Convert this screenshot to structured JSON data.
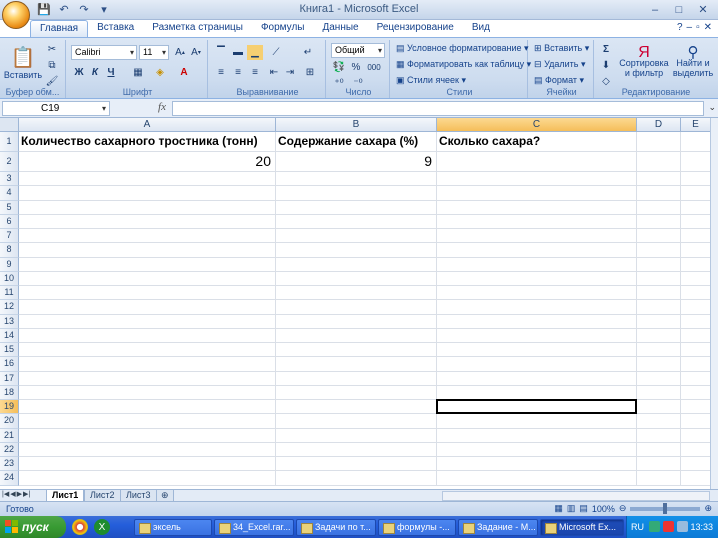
{
  "window": {
    "title": "Книга1 - Microsoft Excel"
  },
  "ribbon_tabs": [
    "Главная",
    "Вставка",
    "Разметка страницы",
    "Формулы",
    "Данные",
    "Рецензирование",
    "Вид"
  ],
  "ribbon": {
    "clipboard": {
      "paste_label": "Вставить",
      "group_label": "Буфер обм..."
    },
    "font": {
      "font_name": "Calibri",
      "font_size": "11",
      "bold": "Ж",
      "italic": "К",
      "underline": "Ч",
      "group_label": "Шрифт"
    },
    "alignment": {
      "group_label": "Выравнивание"
    },
    "number": {
      "format": "Общий",
      "percent": "%",
      "thousands": "000",
      "group_label": "Число"
    },
    "styles": {
      "conditional": "Условное форматирование",
      "table": "Форматировать как таблицу",
      "cell_styles": "Стили ячеек",
      "group_label": "Стили"
    },
    "cells": {
      "insert": "Вставить",
      "delete": "Удалить",
      "format": "Формат",
      "group_label": "Ячейки"
    },
    "editing": {
      "sort_line1": "Сортировка",
      "sort_line2": "и фильтр",
      "find_line1": "Найти и",
      "find_line2": "выделить",
      "group_label": "Редактирование"
    }
  },
  "formula_bar": {
    "name_box": "C19",
    "fx": "fx",
    "formula": ""
  },
  "sheet": {
    "columns": [
      "A",
      "B",
      "C",
      "D",
      "E"
    ],
    "selected_column": "C",
    "rows": [
      "1",
      "2",
      "3",
      "4",
      "5",
      "6",
      "7",
      "8",
      "9",
      "10",
      "11",
      "12",
      "13",
      "14",
      "15",
      "16",
      "17",
      "18",
      "19",
      "20",
      "21",
      "22",
      "23",
      "24"
    ],
    "selected_row": "19",
    "cells": {
      "A1": "Количество сахарного тростника (тонн)",
      "B1": "Содержание сахара (%)",
      "C1": "Сколько сахара?",
      "A2": "20",
      "B2": "9"
    }
  },
  "sheet_tabs": [
    "Лист1",
    "Лист2",
    "Лист3"
  ],
  "status": {
    "ready": "Готово",
    "zoom": "100%"
  },
  "taskbar": {
    "start": "пуск",
    "tasks": [
      "эксель",
      "34_Excel.rar...",
      "Задачи по т...",
      "формулы -...",
      "Задание - М...",
      "Microsoft Ex..."
    ],
    "lang": "RU",
    "time": "13:33"
  }
}
